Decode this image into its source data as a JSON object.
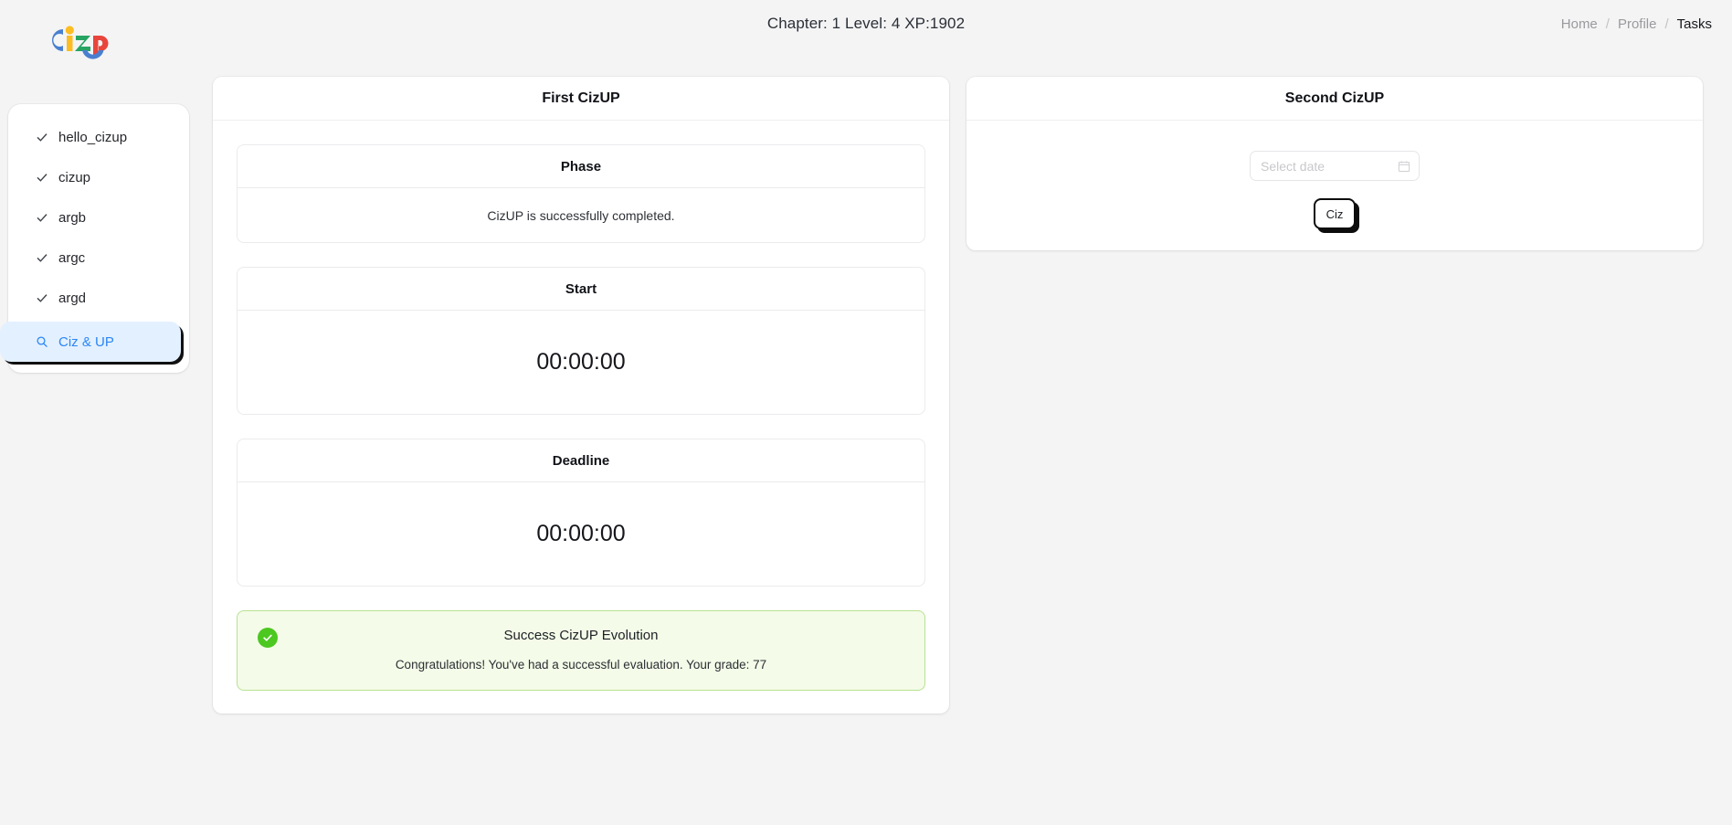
{
  "app": {
    "logo_alt": "cizup-logo",
    "page_title": "Chapter: 1 Level: 4 XP:1902"
  },
  "breadcrumb": {
    "separator": "/",
    "items": [
      {
        "label": "Home",
        "current": false
      },
      {
        "label": "Profile",
        "current": false
      },
      {
        "label": "Tasks",
        "current": true
      }
    ]
  },
  "sidebar": {
    "items": [
      {
        "label": "hello_cizup",
        "icon": "check-icon",
        "selected": false
      },
      {
        "label": "cizup",
        "icon": "check-icon",
        "selected": false
      },
      {
        "label": "argb",
        "icon": "check-icon",
        "selected": false
      },
      {
        "label": "argc",
        "icon": "check-icon",
        "selected": false
      },
      {
        "label": "argd",
        "icon": "check-icon",
        "selected": false
      },
      {
        "label": "Ciz & UP",
        "icon": "magnifier-icon",
        "selected": true
      }
    ]
  },
  "left_panel": {
    "title": "First CizUP",
    "phase": {
      "title": "Phase",
      "value": "CizUP is successfully completed."
    },
    "start": {
      "title": "Start",
      "value": "00:00:00"
    },
    "deadline": {
      "title": "Deadline",
      "value": "00:00:00"
    },
    "alert": {
      "icon": "success-check-icon",
      "title": "Success CizUP Evolution",
      "message": "Congratulations! You've had a successful evaluation. Your grade: 77",
      "grade": 77,
      "color": "#4cc820",
      "background": "#f4fbe8",
      "border": "#b8e293"
    }
  },
  "right_panel": {
    "title": "Second CizUP",
    "date_input": {
      "placeholder": "Select date",
      "value": "",
      "icon": "calendar-icon"
    },
    "submit_button": {
      "label": "Ciz"
    }
  },
  "colors": {
    "background": "#f4f4f5",
    "panel": "#ffffff",
    "accent_blue": "#2b86f5",
    "selected_bg": "#e3f0ff",
    "ink": "#0d0d0d"
  }
}
